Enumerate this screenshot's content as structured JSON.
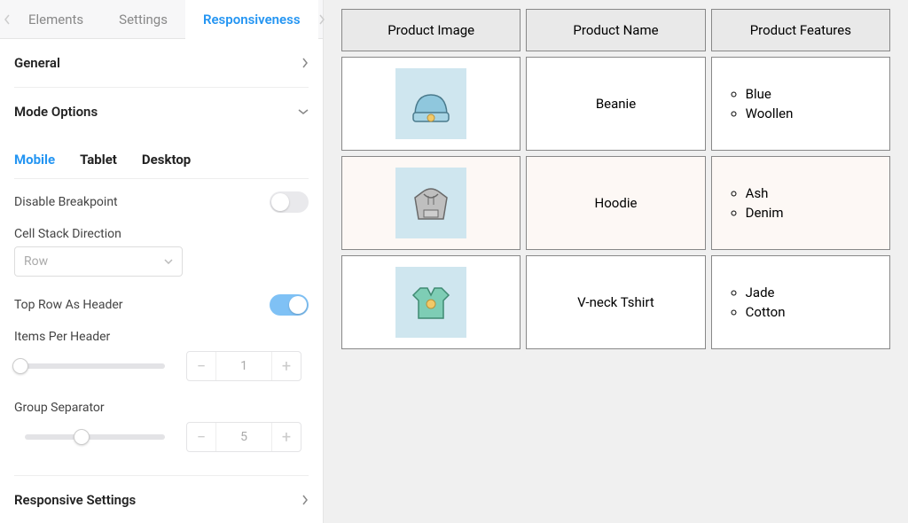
{
  "tabs": {
    "elements": "Elements",
    "settings": "Settings",
    "responsiveness": "Responsiveness"
  },
  "sections": {
    "general": "General",
    "mode_options": "Mode Options",
    "responsive_settings": "Responsive Settings"
  },
  "mode_tabs": {
    "mobile": "Mobile",
    "tablet": "Tablet",
    "desktop": "Desktop"
  },
  "settings": {
    "disable_breakpoint_label": "Disable Breakpoint",
    "disable_breakpoint_value": false,
    "cell_stack_direction_label": "Cell Stack Direction",
    "cell_stack_direction_value": "Row",
    "top_row_as_header_label": "Top Row As Header",
    "top_row_as_header_value": true,
    "items_per_header_label": "Items Per Header",
    "items_per_header_value": "1",
    "group_separator_label": "Group Separator",
    "group_separator_value": "5"
  },
  "table": {
    "headers": {
      "image": "Product Image",
      "name": "Product Name",
      "features": "Product Features"
    },
    "rows": [
      {
        "name": "Beanie",
        "features": [
          "Blue",
          "Woollen"
        ],
        "icon": "beanie-icon"
      },
      {
        "name": "Hoodie",
        "features": [
          "Ash",
          "Denim"
        ],
        "icon": "hoodie-icon"
      },
      {
        "name": "V-neck Tshirt",
        "features": [
          "Jade",
          "Cotton"
        ],
        "icon": "tshirt-icon"
      }
    ]
  },
  "icons": {
    "minus": "−",
    "plus": "+"
  }
}
